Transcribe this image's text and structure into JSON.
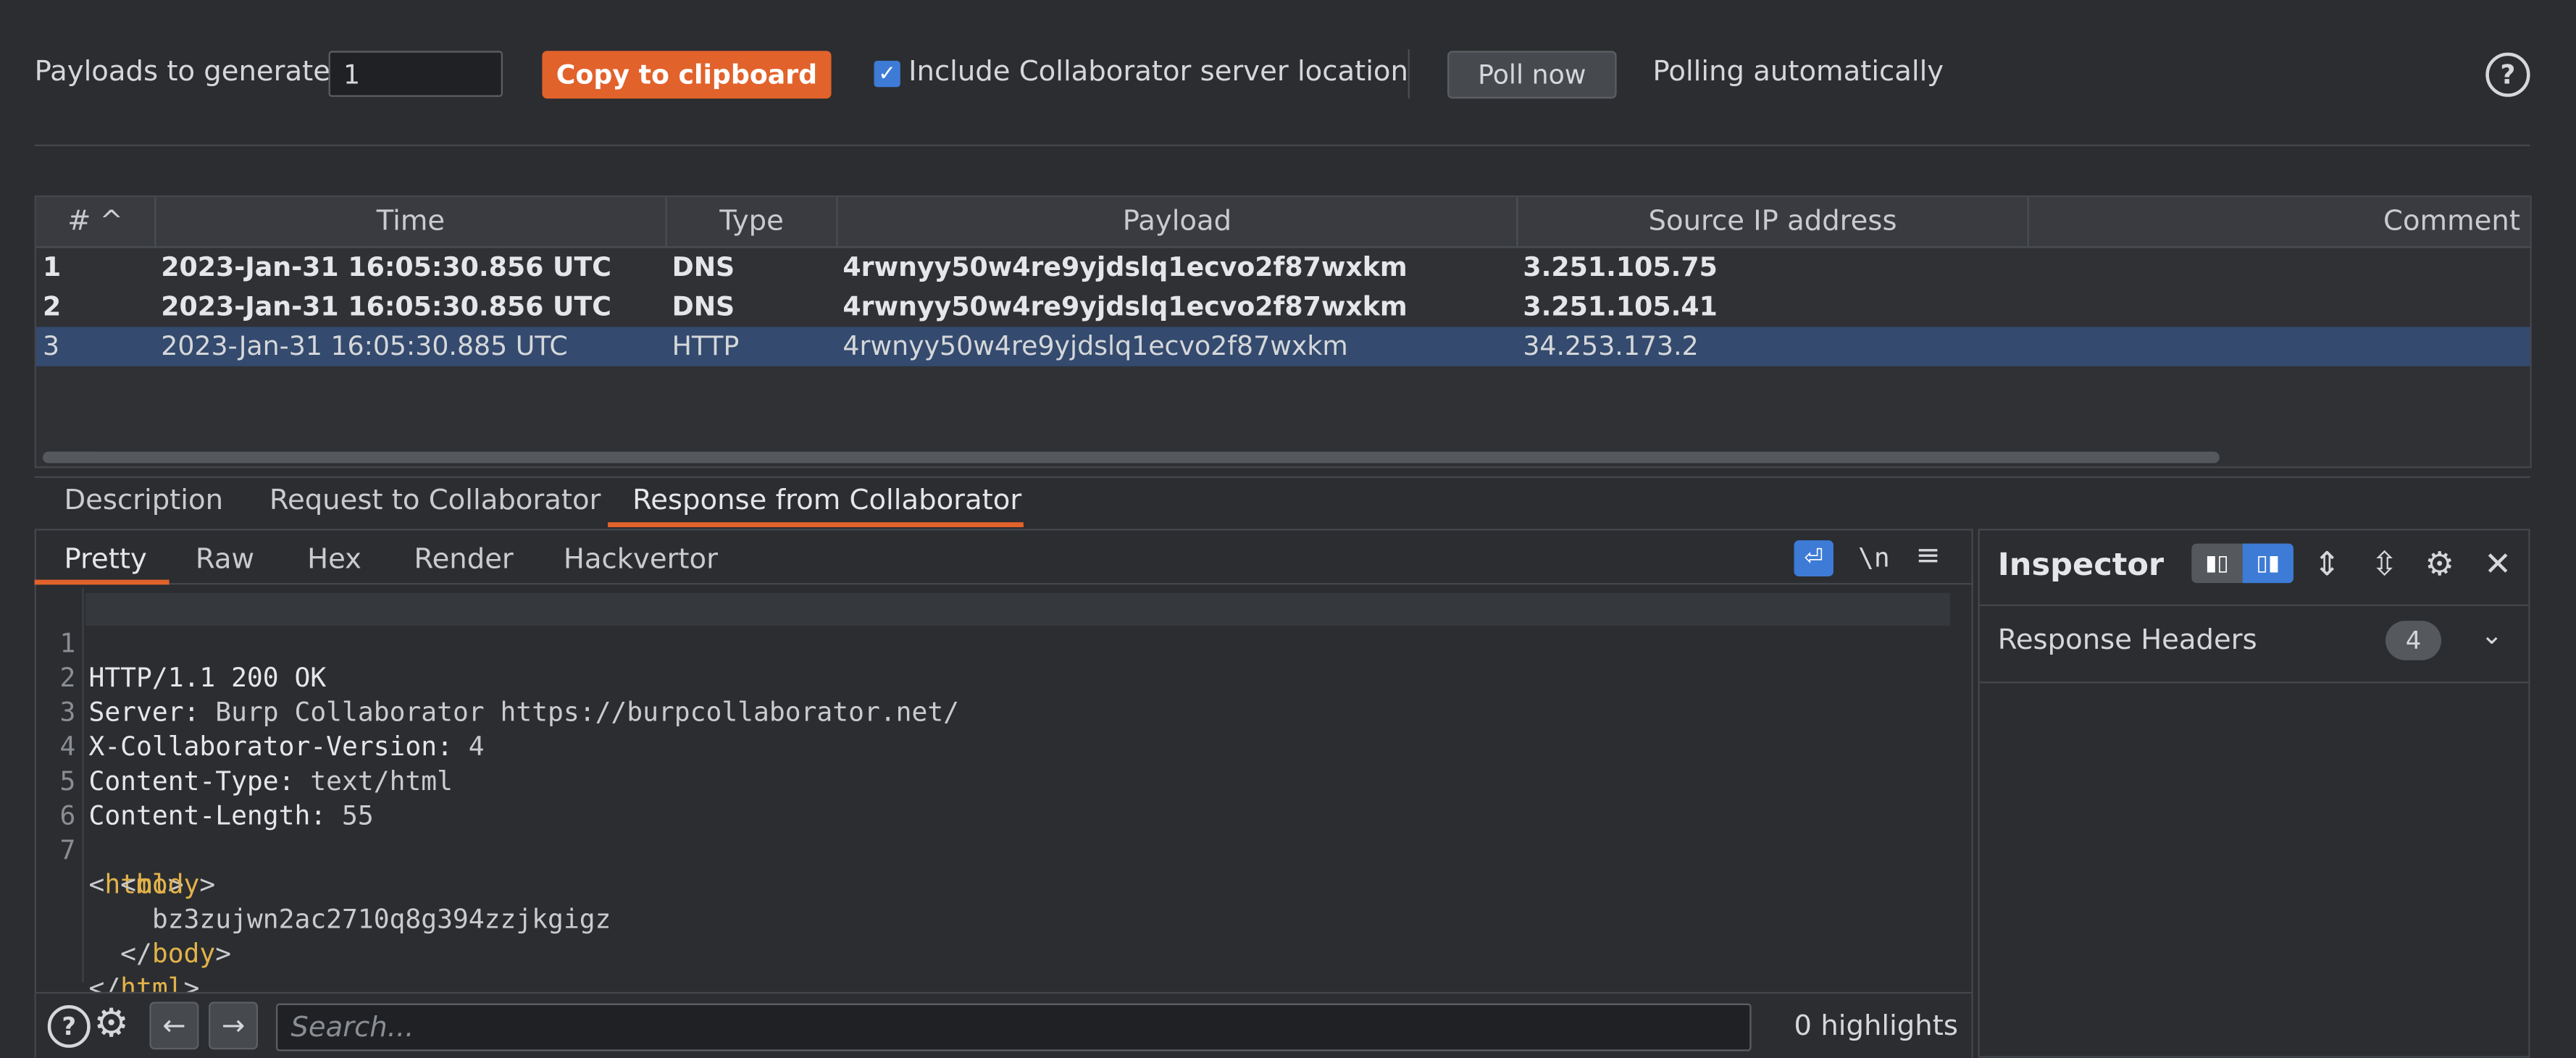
{
  "toolbar": {
    "payloads_label": "Payloads to generate:",
    "payloads_value": "1",
    "copy_button": "Copy to clipboard",
    "include_location_label": "Include Collaborator server location",
    "include_location_checked": true,
    "poll_button": "Poll now",
    "polling_status": "Polling automatically",
    "help_glyph": "?"
  },
  "table": {
    "columns": [
      "# ^",
      "Time",
      "Type",
      "Payload",
      "Source IP address",
      "Comment"
    ],
    "rows": [
      {
        "num": "1",
        "time": "2023-Jan-31 16:05:30.856 UTC",
        "type": "DNS",
        "payload": "4rwnyy50w4re9yjdslq1ecvo2f87wxkm",
        "ip": "3.251.105.75",
        "comment": ""
      },
      {
        "num": "2",
        "time": "2023-Jan-31 16:05:30.856 UTC",
        "type": "DNS",
        "payload": "4rwnyy50w4re9yjdslq1ecvo2f87wxkm",
        "ip": "3.251.105.41",
        "comment": ""
      },
      {
        "num": "3",
        "time": "2023-Jan-31 16:05:30.885 UTC",
        "type": "HTTP",
        "payload": "4rwnyy50w4re9yjdslq1ecvo2f87wxkm",
        "ip": "34.253.173.2",
        "comment": ""
      }
    ]
  },
  "detail_tabs": [
    "Description",
    "Request to Collaborator",
    "Response from Collaborator"
  ],
  "editor_tabs": [
    "Pretty",
    "Raw",
    "Hex",
    "Render",
    "Hackvertor"
  ],
  "editor_icons": {
    "newline": "\\n",
    "menu": "≡"
  },
  "code": {
    "line_numbers": [
      "1",
      "2",
      "3",
      "4",
      "5",
      "6",
      "7",
      "",
      "",
      "",
      ""
    ],
    "l1": "HTTP/1.1 200 OK",
    "l2_name": "Server:",
    "l2_value": " Burp Collaborator https://burpcollaborator.net/",
    "l3_name": "X-Collaborator-Version:",
    "l3_value": " 4",
    "l4_name": "Content-Type:",
    "l4_value": " text/html",
    "l5_name": "Content-Length:",
    "l5_value": " 55",
    "l7_open": "<",
    "l7_tag": "html",
    "l7_close": ">",
    "l8_open": "  <",
    "l8_tag": "body",
    "l8_close": ">",
    "l9": "    bz3zujwn2ac2710q8g394zzjkgigz",
    "l10_open": "  </",
    "l10_tag": "body",
    "l10_close": ">",
    "l11_open": "</",
    "l11_tag": "html",
    "l11_close": ">"
  },
  "bottom": {
    "search_placeholder": "Search...",
    "highlights": "0 highlights"
  },
  "inspector": {
    "title": "Inspector",
    "section": "Response Headers",
    "count": "4"
  }
}
